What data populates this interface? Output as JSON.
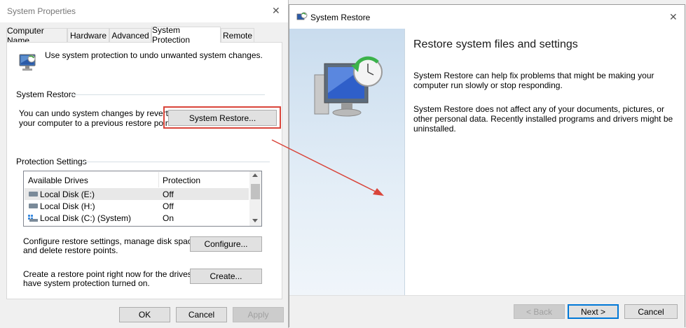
{
  "sys_props": {
    "title": "System Properties",
    "close_glyph": "✕",
    "tabs": [
      "Computer Name",
      "Hardware",
      "Advanced",
      "System Protection",
      "Remote"
    ],
    "intro": "Use system protection to undo unwanted system changes.",
    "restore_group": "System Restore",
    "restore_text_1": "You can undo system changes by reverting",
    "restore_text_2": "your computer to a previous restore point.",
    "restore_button": "System Restore...",
    "protection_group": "Protection Settings",
    "col_drives": "Available Drives",
    "col_protection": "Protection",
    "drives": [
      {
        "name": "Local Disk (E:)",
        "protection": "Off"
      },
      {
        "name": "Local Disk (H:)",
        "protection": "Off"
      },
      {
        "name": "Local Disk (C:) (System)",
        "protection": "On"
      }
    ],
    "configure_text_1": "Configure restore settings, manage disk space,",
    "configure_text_2": "and delete restore points.",
    "configure_button": "Configure...",
    "create_text_1": "Create a restore point right now for the drives that",
    "create_text_2": "have system protection turned on.",
    "create_button": "Create...",
    "ok": "OK",
    "cancel": "Cancel",
    "apply": "Apply"
  },
  "restore_wizard": {
    "title": "System Restore",
    "close_glyph": "✕",
    "heading": "Restore system files and settings",
    "para1_line1": "System Restore can help fix problems that might be making your",
    "para1_line2": "computer run slowly or stop responding.",
    "para2_line1": "System Restore does not affect any of your documents, pictures, or",
    "para2_line2": "other personal data. Recently installed programs and drivers might be",
    "para2_line3": "uninstalled.",
    "back": "< Back",
    "next": "Next >",
    "cancel": "Cancel"
  },
  "colors": {
    "highlight_box": "#d9453a",
    "arrow": "#d9453a",
    "primary_button_border": "#0078d7",
    "wizard_sidebar": "#dbe8f3"
  }
}
